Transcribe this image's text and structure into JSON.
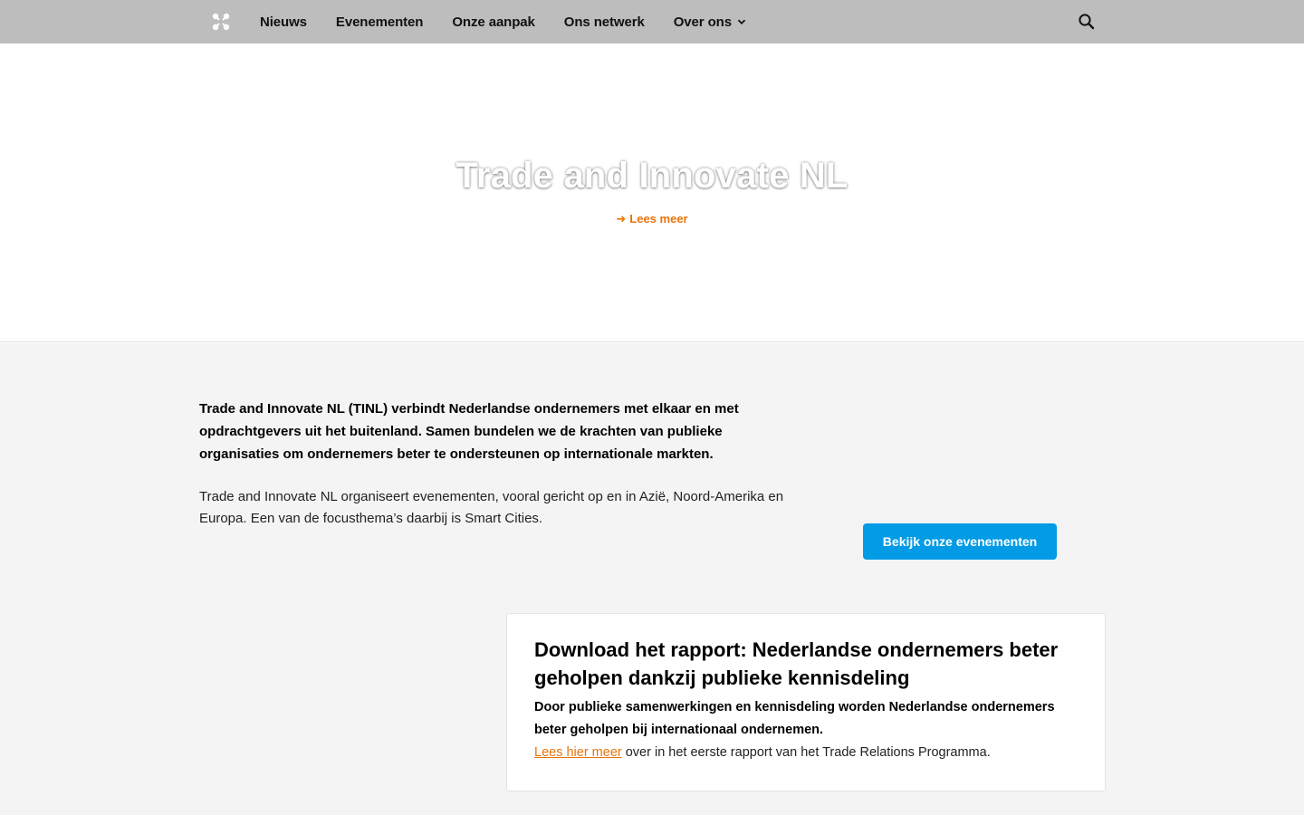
{
  "header": {
    "nav": [
      {
        "label": "Nieuws"
      },
      {
        "label": "Evenementen"
      },
      {
        "label": "Onze aanpak"
      },
      {
        "label": "Ons netwerk"
      },
      {
        "label": "Over ons"
      }
    ]
  },
  "hero": {
    "title": "Trade and Innovate NL",
    "link_label": "Lees meer"
  },
  "intro": {
    "bold": "Trade and Innovate NL (TINL) verbindt Nederlandse ondernemers met elkaar en met opdrachtgevers uit het buitenland. Samen bundelen we de krachten van publieke organisaties om ondernemers beter te ondersteunen op internationale markten.",
    "text": "Trade and Innovate NL organiseert evenementen, vooral gericht op en in Azië, Noord-Amerika en Europa. Een van de focusthema’s daarbij is Smart Cities.",
    "cta_label": "Bekijk onze evenementen"
  },
  "report_card": {
    "title": "Download het rapport: Nederlandse ondernemers beter geholpen dankzij publieke kennisdeling",
    "bold": "Door publieke samenwerkingen en kennisdeling worden Nederlandse ondernemers beter geholpen bij internationaal ondernemen.",
    "link_label": "Lees hier meer",
    "rest": " over in het eerste rapport van het Trade Relations Programma."
  },
  "colors": {
    "accent_orange": "#e8730c",
    "button_blue": "#039be5",
    "header_grey": "#bdbdbd"
  }
}
